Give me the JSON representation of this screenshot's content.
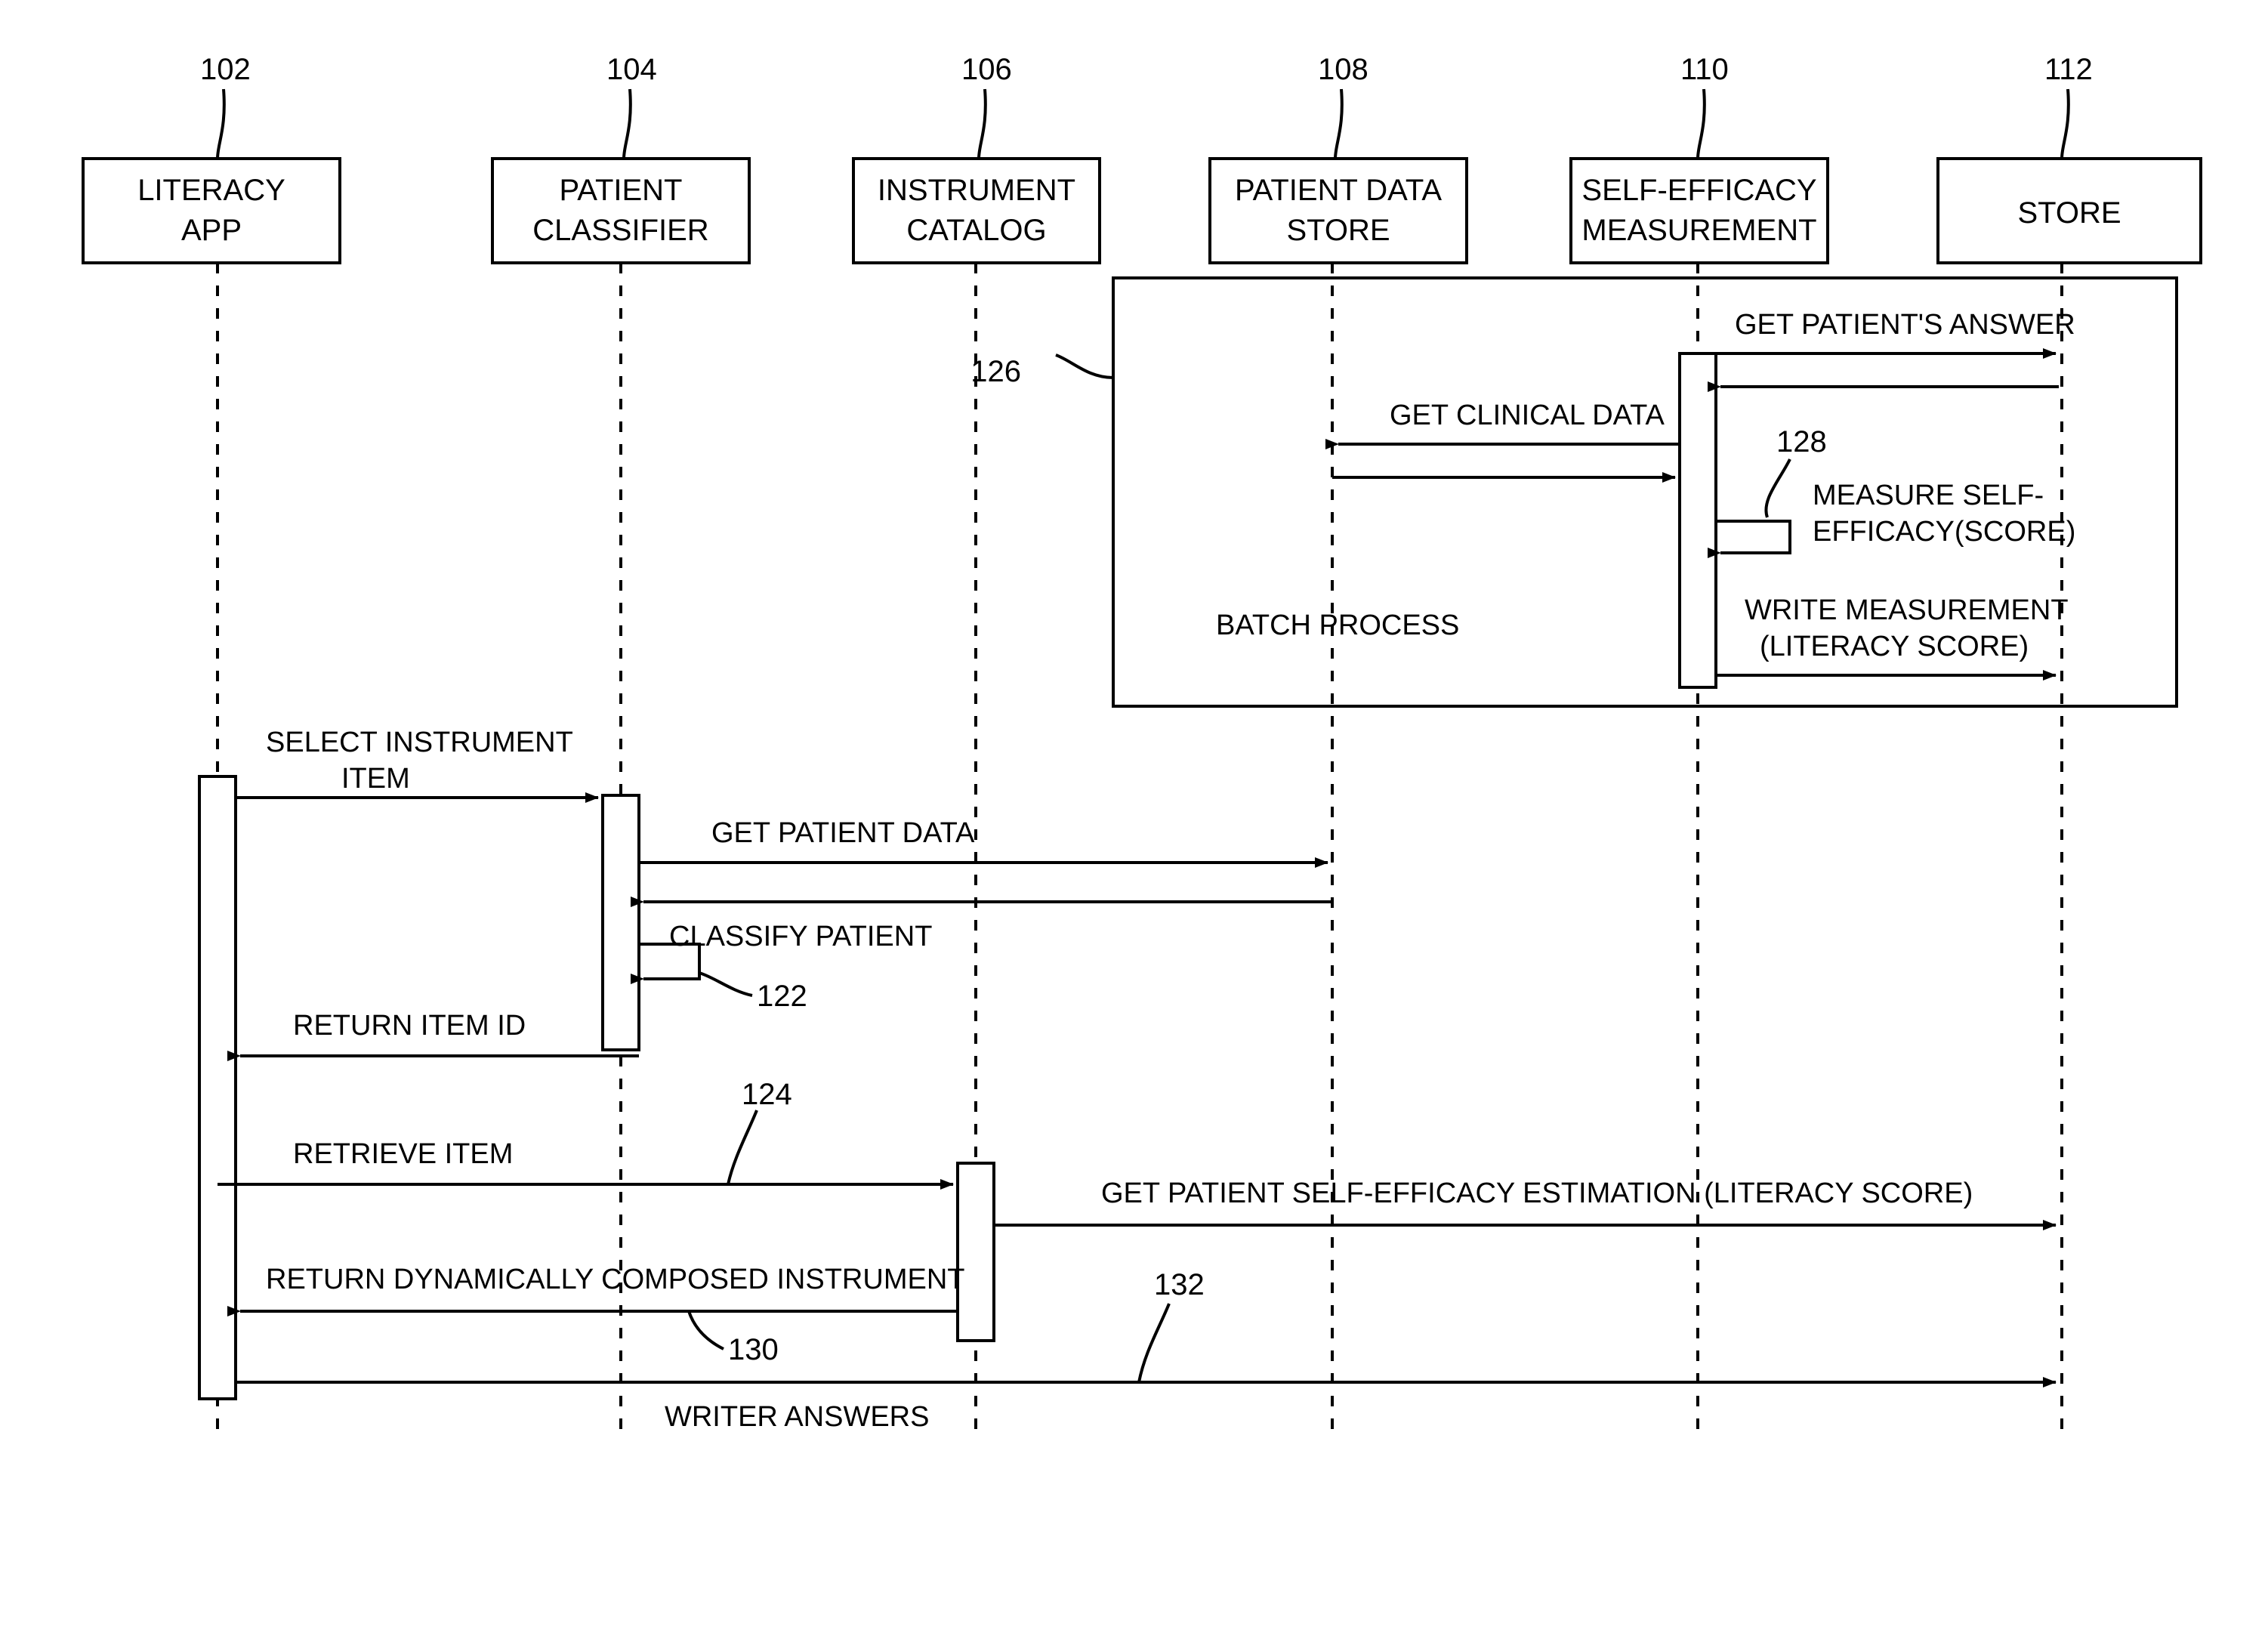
{
  "diagram": {
    "title": "Patient literacy self-efficacy sequence diagram",
    "stroke_color": "#000000",
    "background_color": "#ffffff"
  },
  "participants": [
    {
      "ref": "102",
      "name": "LITERACY APP",
      "line1": "LITERACY",
      "line2": "APP"
    },
    {
      "ref": "104",
      "name": "PATIENT CLASSIFIER",
      "line1": "PATIENT",
      "line2": "CLASSIFIER"
    },
    {
      "ref": "106",
      "name": "INSTRUMENT CATALOG",
      "line1": "INSTRUMENT",
      "line2": "CATALOG"
    },
    {
      "ref": "108",
      "name": "PATIENT DATA STORE",
      "line1": "PATIENT DATA",
      "line2": "STORE"
    },
    {
      "ref": "110",
      "name": "SELF-EFFICACY MEASUREMENT",
      "line1": "SELF-EFFICACY",
      "line2": "MEASUREMENT"
    },
    {
      "ref": "112",
      "name": "STORE",
      "line1": "STORE",
      "line2": ""
    }
  ],
  "frames": [
    {
      "ref": "126",
      "label": "BATCH PROCESS"
    }
  ],
  "messages": [
    {
      "ref": "",
      "label": "GET PATIENT'S ANSWER",
      "from": "SELF-EFFICACY MEASUREMENT",
      "to": "STORE",
      "direction": "right"
    },
    {
      "ref": "",
      "label": "",
      "from": "STORE",
      "to": "SELF-EFFICACY MEASUREMENT",
      "direction": "left"
    },
    {
      "ref": "",
      "label": "GET CLINICAL DATA",
      "from": "SELF-EFFICACY MEASUREMENT",
      "to": "PATIENT DATA STORE",
      "direction": "left"
    },
    {
      "ref": "",
      "label": "",
      "from": "PATIENT DATA STORE",
      "to": "SELF-EFFICACY MEASUREMENT",
      "direction": "right"
    },
    {
      "ref": "128",
      "label": "MEASURE SELF-EFFICACY(SCORE)",
      "line1": "MEASURE SELF-",
      "line2": "EFFICACY(SCORE)",
      "from": "SELF-EFFICACY MEASUREMENT",
      "to": "SELF-EFFICACY MEASUREMENT",
      "direction": "self"
    },
    {
      "ref": "",
      "label": "WRITE MEASUREMENT (LITERACY SCORE)",
      "line1": "WRITE MEASUREMENT",
      "line2": "(LITERACY SCORE)",
      "from": "SELF-EFFICACY MEASUREMENT",
      "to": "STORE",
      "direction": "right"
    },
    {
      "ref": "",
      "label": "SELECT INSTRUMENT ITEM",
      "line1": "SELECT INSTRUMENT",
      "line2": "ITEM",
      "from": "LITERACY APP",
      "to": "PATIENT CLASSIFIER",
      "direction": "right"
    },
    {
      "ref": "",
      "label": "GET PATIENT DATA",
      "from": "PATIENT CLASSIFIER",
      "to": "PATIENT DATA STORE",
      "direction": "right"
    },
    {
      "ref": "",
      "label": "",
      "from": "PATIENT DATA STORE",
      "to": "PATIENT CLASSIFIER",
      "direction": "left"
    },
    {
      "ref": "122",
      "label": "CLASSIFY PATIENT",
      "from": "PATIENT CLASSIFIER",
      "to": "PATIENT CLASSIFIER",
      "direction": "self"
    },
    {
      "ref": "",
      "label": "RETURN ITEM ID",
      "from": "PATIENT CLASSIFIER",
      "to": "LITERACY APP",
      "direction": "left"
    },
    {
      "ref": "124",
      "label": "RETRIEVE ITEM",
      "from": "LITERACY APP",
      "to": "INSTRUMENT CATALOG",
      "direction": "right"
    },
    {
      "ref": "",
      "label": "GET PATIENT SELF-EFFICACY ESTIMATION (LITERACY SCORE)",
      "from": "INSTRUMENT CATALOG",
      "to": "STORE",
      "direction": "right"
    },
    {
      "ref": "130",
      "label": "RETURN DYNAMICALLY COMPOSED INSTRUMENT",
      "from": "INSTRUMENT CATALOG",
      "to": "LITERACY APP",
      "direction": "left"
    },
    {
      "ref": "132",
      "label": "WRITER ANSWERS",
      "from": "LITERACY APP",
      "to": "STORE",
      "direction": "right"
    }
  ],
  "reference_numerals": [
    "102",
    "104",
    "106",
    "108",
    "110",
    "112",
    "122",
    "124",
    "126",
    "128",
    "130",
    "132"
  ],
  "text": {
    "p102_ref": "102",
    "p104_ref": "104",
    "p106_ref": "106",
    "p108_ref": "108",
    "p110_ref": "110",
    "p112_ref": "112",
    "p102_l1": "LITERACY",
    "p102_l2": "APP",
    "p104_l1": "PATIENT",
    "p104_l2": "CLASSIFIER",
    "p106_l1": "INSTRUMENT",
    "p106_l2": "CATALOG",
    "p108_l1": "PATIENT DATA",
    "p108_l2": "STORE",
    "p110_l1": "SELF-EFFICACY",
    "p110_l2": "MEASUREMENT",
    "p112_l1": "STORE",
    "m_get_patients_answer": "GET PATIENT'S ANSWER",
    "m_get_clinical_data": "GET CLINICAL DATA",
    "m_measure_l1": "MEASURE SELF-",
    "m_measure_l2": "EFFICACY(SCORE)",
    "m_write_l1": "WRITE MEASUREMENT",
    "m_write_l2": "(LITERACY SCORE)",
    "m_batch_process": "BATCH PROCESS",
    "m_select_l1": "SELECT INSTRUMENT",
    "m_select_l2": "ITEM",
    "m_get_patient_data": "GET PATIENT DATA",
    "m_classify_patient": "CLASSIFY PATIENT",
    "m_return_item_id": "RETURN ITEM ID",
    "m_retrieve_item": "RETRIEVE ITEM",
    "m_get_estimation": "GET PATIENT SELF-EFFICACY ESTIMATION (LITERACY SCORE)",
    "m_return_instrument": "RETURN DYNAMICALLY COMPOSED INSTRUMENT",
    "m_writer_answers": "WRITER ANSWERS",
    "r122": "122",
    "r124": "124",
    "r126": "126",
    "r128": "128",
    "r130": "130",
    "r132": "132"
  }
}
